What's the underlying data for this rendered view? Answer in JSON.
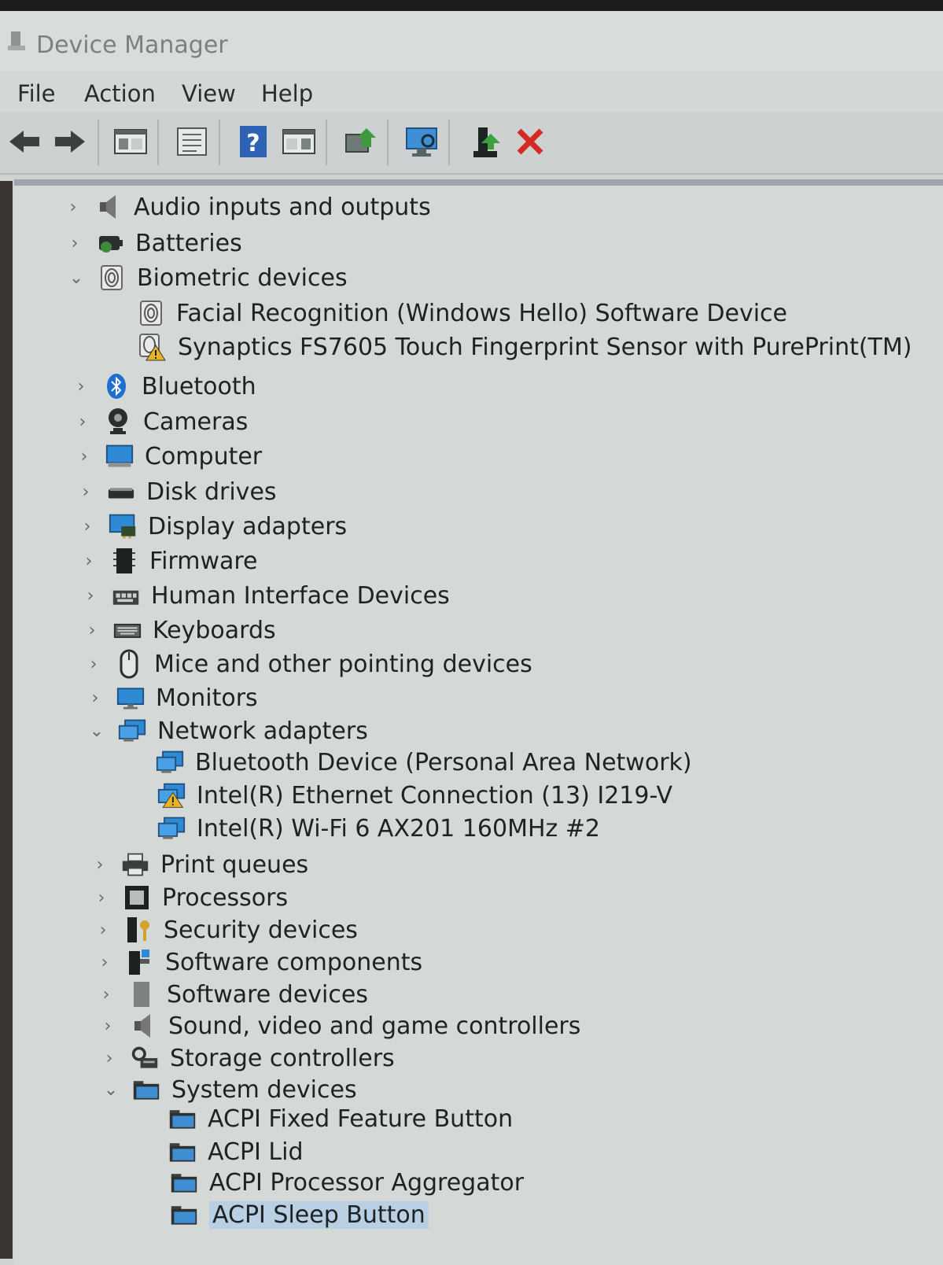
{
  "window": {
    "title": "Device Manager"
  },
  "menu": [
    "File",
    "Action",
    "View",
    "Help"
  ],
  "toolbar": [
    "back-icon",
    "forward-icon",
    "show-hide-console-tree-icon",
    "properties-icon",
    "help-icon",
    "action-pane-icon",
    "update-driver-icon",
    "scan-hardware-icon",
    "enable-device-icon",
    "uninstall-icon"
  ],
  "tree": {
    "audio": "Audio inputs and outputs",
    "batteries": "Batteries",
    "biometric": "Biometric devices",
    "biometric_children": [
      "Facial Recognition (Windows Hello) Software Device",
      "Synaptics FS7605 Touch Fingerprint Sensor with PurePrint(TM)"
    ],
    "bluetooth": "Bluetooth",
    "cameras": "Cameras",
    "computer": "Computer",
    "disk": "Disk drives",
    "display": "Display adapters",
    "firmware": "Firmware",
    "hid": "Human Interface Devices",
    "keyboards": "Keyboards",
    "mice": "Mice and other pointing devices",
    "monitors": "Monitors",
    "network": "Network adapters",
    "network_children": [
      "Bluetooth Device (Personal Area Network)",
      "Intel(R) Ethernet Connection (13) I219-V",
      "Intel(R) Wi-Fi 6 AX201 160MHz #2"
    ],
    "print": "Print queues",
    "processors": "Processors",
    "security": "Security devices",
    "swcomponents": "Software components",
    "swdevices": "Software devices",
    "sound": "Sound, video and game controllers",
    "storage": "Storage controllers",
    "system": "System devices",
    "system_children": [
      "ACPI Fixed Feature Button",
      "ACPI Lid",
      "ACPI Processor Aggregator",
      "ACPI Sleep Button"
    ]
  },
  "colors": {
    "selection": "#b9cfe4",
    "warning": "#e8b423",
    "uninstall_red": "#d42a22"
  }
}
